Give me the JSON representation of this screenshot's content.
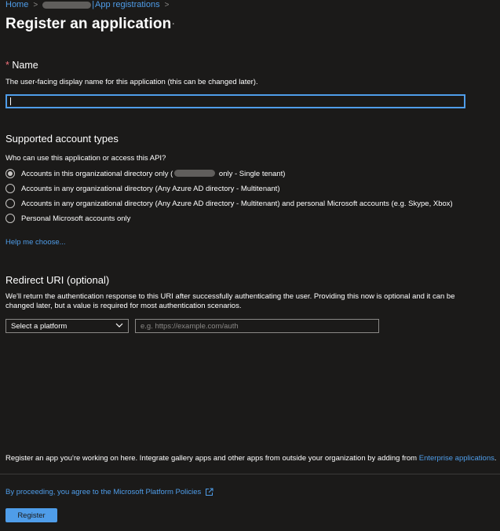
{
  "breadcrumb": {
    "home": "Home",
    "app_registrations": "App registrations"
  },
  "page": {
    "title": "Register an application",
    "more": "···"
  },
  "name_section": {
    "required_marker": "*",
    "label": "Name",
    "description": "The user-facing display name for this application (this can be changed later).",
    "value": ""
  },
  "account_types": {
    "heading": "Supported account types",
    "question": "Who can use this application or access this API?",
    "options": [
      {
        "before": "Accounts in this organizational directory only (",
        "after": " only - Single tenant)",
        "selected": true
      },
      {
        "label": "Accounts in any organizational directory (Any Azure AD directory - Multitenant)",
        "selected": false
      },
      {
        "label": "Accounts in any organizational directory (Any Azure AD directory - Multitenant) and personal Microsoft accounts (e.g. Skype, Xbox)",
        "selected": false
      },
      {
        "label": "Personal Microsoft accounts only",
        "selected": false
      }
    ],
    "help_link": "Help me choose..."
  },
  "redirect_uri": {
    "heading": "Redirect URI (optional)",
    "description": "We'll return the authentication response to this URI after successfully authenticating the user. Providing this now is optional and it can be changed later, but a value is required for most authentication scenarios.",
    "platform_select": "Select a platform",
    "uri_placeholder": "e.g. https://example.com/auth"
  },
  "footer": {
    "info_text": "Register an app you're working on here. Integrate gallery apps and other apps from outside your organization by adding from ",
    "enterprise_link": "Enterprise applications",
    "info_end": ".",
    "policies_link": "By proceeding, you agree to the Microsoft Platform Policies",
    "register_button": "Register"
  },
  "colors": {
    "background": "#1b1a19",
    "accent": "#4f9de9",
    "required": "#f1707b"
  }
}
